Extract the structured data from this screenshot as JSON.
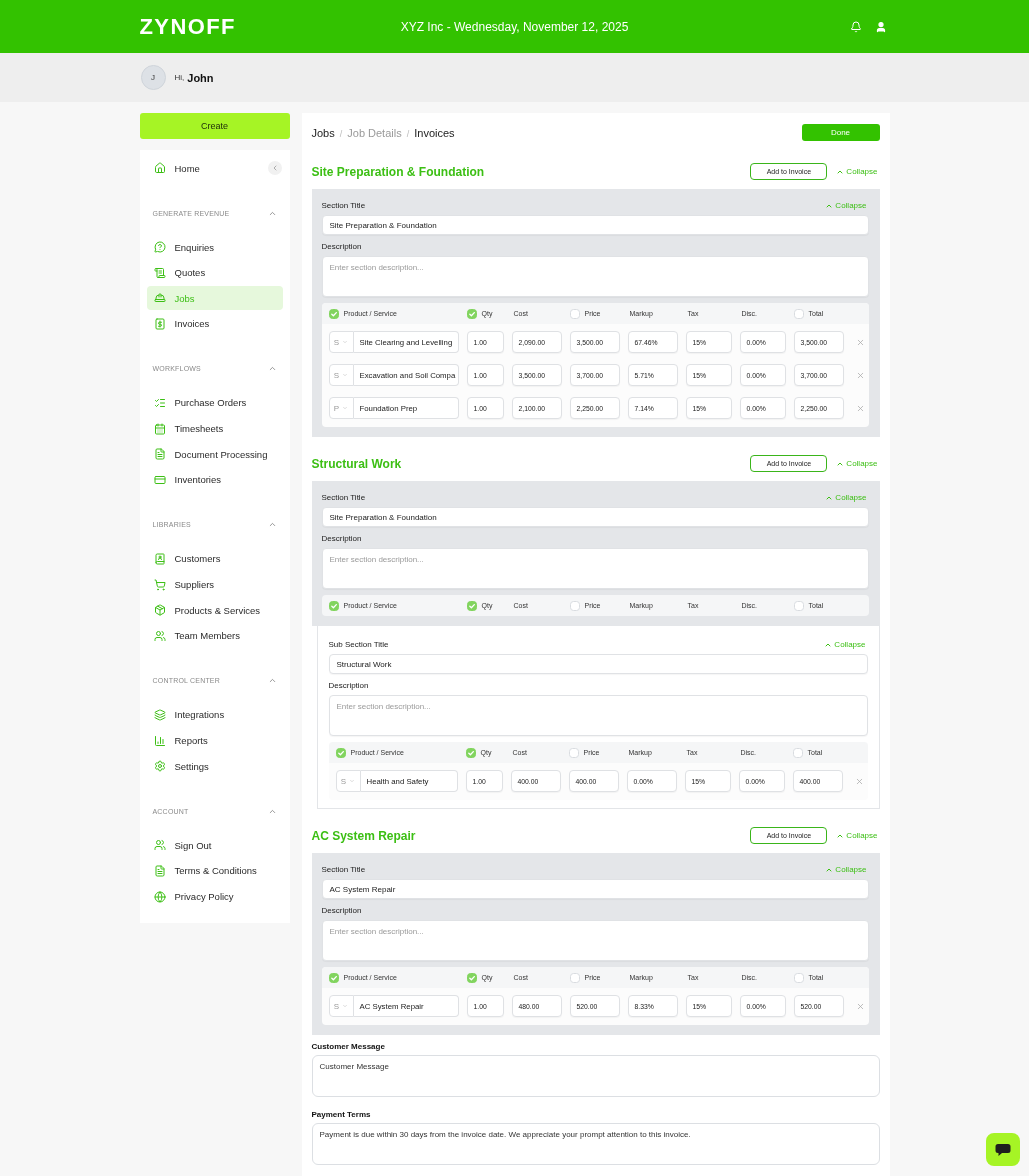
{
  "header": {
    "logo": "ZYNOFF",
    "title": "XYZ Inc - Wednesday, November 12, 2025"
  },
  "greeting": {
    "initial": "J",
    "salutation": "Hi,",
    "name": "John"
  },
  "sidebar": {
    "create_button": "Create",
    "home": {
      "label": "Home",
      "selected": false
    },
    "groups": [
      {
        "title": "GENERATE REVENUE",
        "expanded": true,
        "items": [
          {
            "label": "Enquiries",
            "selected": false
          },
          {
            "label": "Quotes",
            "selected": false
          },
          {
            "label": "Jobs",
            "selected": true
          },
          {
            "label": "Invoices",
            "selected": false
          }
        ]
      },
      {
        "title": "WORKFLOWS",
        "expanded": true,
        "items": [
          {
            "label": "Purchase Orders",
            "selected": false
          },
          {
            "label": "Timesheets",
            "selected": false
          },
          {
            "label": "Document Processing",
            "selected": false
          },
          {
            "label": "Inventories",
            "selected": false
          }
        ]
      },
      {
        "title": "LIBRARIES",
        "expanded": true,
        "items": [
          {
            "label": "Customers",
            "selected": false
          },
          {
            "label": "Suppliers",
            "selected": false
          },
          {
            "label": "Products & Services",
            "selected": false
          },
          {
            "label": "Team Members",
            "selected": false
          }
        ]
      },
      {
        "title": "CONTROL CENTER",
        "expanded": true,
        "items": [
          {
            "label": "Integrations",
            "selected": false
          },
          {
            "label": "Reports",
            "selected": false
          },
          {
            "label": "Settings",
            "selected": false
          }
        ]
      },
      {
        "title": "ACCOUNT",
        "expanded": true,
        "items": [
          {
            "label": "Sign Out",
            "selected": false
          },
          {
            "label": "Terms & Conditions",
            "selected": false
          },
          {
            "label": "Privacy Policy",
            "selected": false
          }
        ]
      }
    ]
  },
  "breadcrumb": [
    {
      "label": "Jobs",
      "kind": "link"
    },
    {
      "label": "/",
      "kind": "separator"
    },
    {
      "label": "Job Details",
      "kind": "muted"
    },
    {
      "label": "/",
      "kind": "separator"
    },
    {
      "label": "Invoices",
      "kind": "current"
    }
  ],
  "done_button": "Done",
  "sections": [
    {
      "heading": "Site Preparation & Foundation",
      "add_button": "Add to Invoice",
      "collapse": {
        "label": "Collapse",
        "expanded": true
      },
      "panel": {
        "title_label": "Section Title",
        "title": "Site Preparation & Foundation",
        "collapse": {
          "label": "Collapse",
          "expanded": true
        },
        "description_label": "Description",
        "description_placeholder": "Enter section description...",
        "columns": [
          {
            "label": "Product / Service",
            "kind": "check",
            "checked": true
          },
          {
            "label": "Qty",
            "kind": "check",
            "checked": true
          },
          {
            "label": "Cost",
            "kind": "plain"
          },
          {
            "label": "Price",
            "kind": "check",
            "checked": false
          },
          {
            "label": "Markup",
            "kind": "plain"
          },
          {
            "label": "Tax",
            "kind": "plain"
          },
          {
            "label": "Disc.",
            "kind": "plain"
          },
          {
            "label": "Total",
            "kind": "check",
            "checked": false
          }
        ],
        "rows": [
          {
            "type": "S",
            "name": "Site Clearing and Levelling",
            "qty": "1.00",
            "cost": "2,090.00",
            "price": "3,500.00",
            "markup": "67.46%",
            "tax": "15%",
            "discount": "0.00%",
            "total": "3,500.00"
          },
          {
            "type": "S",
            "name": "Excavation and Soil Compa",
            "qty": "1.00",
            "cost": "3,500.00",
            "price": "3,700.00",
            "markup": "5.71%",
            "tax": "15%",
            "discount": "0.00%",
            "total": "3,700.00"
          },
          {
            "type": "P",
            "name": "Foundation Prep",
            "qty": "1.00",
            "cost": "2,100.00",
            "price": "2,250.00",
            "markup": "7.14%",
            "tax": "15%",
            "discount": "0.00%",
            "total": "2,250.00"
          }
        ]
      }
    },
    {
      "heading": "Structural Work",
      "add_button": "Add to Invoice",
      "collapse": {
        "label": "Collapse",
        "expanded": true
      },
      "panel": {
        "title_label": "Section Title",
        "title": "Site Preparation & Foundation",
        "collapse": {
          "label": "Collapse",
          "expanded": true
        },
        "description_label": "Description",
        "description_placeholder": "Enter section description...",
        "columns": [
          {
            "label": "Product / Service",
            "kind": "check",
            "checked": true
          },
          {
            "label": "Qty",
            "kind": "check",
            "checked": true
          },
          {
            "label": "Cost",
            "kind": "plain"
          },
          {
            "label": "Price",
            "kind": "check",
            "checked": false
          },
          {
            "label": "Markup",
            "kind": "plain"
          },
          {
            "label": "Tax",
            "kind": "plain"
          },
          {
            "label": "Disc.",
            "kind": "plain"
          },
          {
            "label": "Total",
            "kind": "check",
            "checked": false
          }
        ]
      },
      "subsections": [
        {
          "title_label": "Sub Section Title",
          "title": "Structural Work",
          "collapse": {
            "label": "Collapse",
            "expanded": true
          },
          "description_label": "Description",
          "description_placeholder": "Enter section description...",
          "columns": [
            {
              "label": "Product / Service",
              "kind": "check",
              "checked": true
            },
            {
              "label": "Qty",
              "kind": "check",
              "checked": true
            },
            {
              "label": "Cost",
              "kind": "plain"
            },
            {
              "label": "Price",
              "kind": "check",
              "checked": false
            },
            {
              "label": "Markup",
              "kind": "plain"
            },
            {
              "label": "Tax",
              "kind": "plain"
            },
            {
              "label": "Disc.",
              "kind": "plain"
            },
            {
              "label": "Total",
              "kind": "check",
              "checked": false
            }
          ],
          "rows": [
            {
              "type": "S",
              "name": "Health and Safety",
              "qty": "1.00",
              "cost": "400.00",
              "price": "400.00",
              "markup": "0.00%",
              "tax": "15%",
              "discount": "0.00%",
              "total": "400.00"
            }
          ]
        }
      ]
    },
    {
      "heading": "AC System Repair",
      "add_button": "Add to Invoice",
      "collapse": {
        "label": "Collapse",
        "expanded": true
      },
      "panel": {
        "title_label": "Section Title",
        "title": "AC System Repair",
        "collapse": {
          "label": "Collapse",
          "expanded": true
        },
        "description_label": "Description",
        "description_placeholder": "Enter section description...",
        "columns": [
          {
            "label": "Product / Service",
            "kind": "check",
            "checked": true
          },
          {
            "label": "Qty",
            "kind": "check",
            "checked": true
          },
          {
            "label": "Cost",
            "kind": "plain"
          },
          {
            "label": "Price",
            "kind": "check",
            "checked": false
          },
          {
            "label": "Markup",
            "kind": "plain"
          },
          {
            "label": "Tax",
            "kind": "plain"
          },
          {
            "label": "Disc.",
            "kind": "plain"
          },
          {
            "label": "Total",
            "kind": "check",
            "checked": false
          }
        ],
        "rows": [
          {
            "type": "S",
            "name": "AC System Repair",
            "qty": "1.00",
            "cost": "480.00",
            "price": "520.00",
            "markup": "8.33%",
            "tax": "15%",
            "discount": "0.00%",
            "total": "520.00"
          }
        ]
      }
    }
  ],
  "customer_message": {
    "label": "Customer Message",
    "value": "Customer Message"
  },
  "payment_terms": {
    "label": "Payment Terms",
    "value": "Payment is due within 30 days from the invoice date. We appreciate your prompt attention to this invoice."
  }
}
